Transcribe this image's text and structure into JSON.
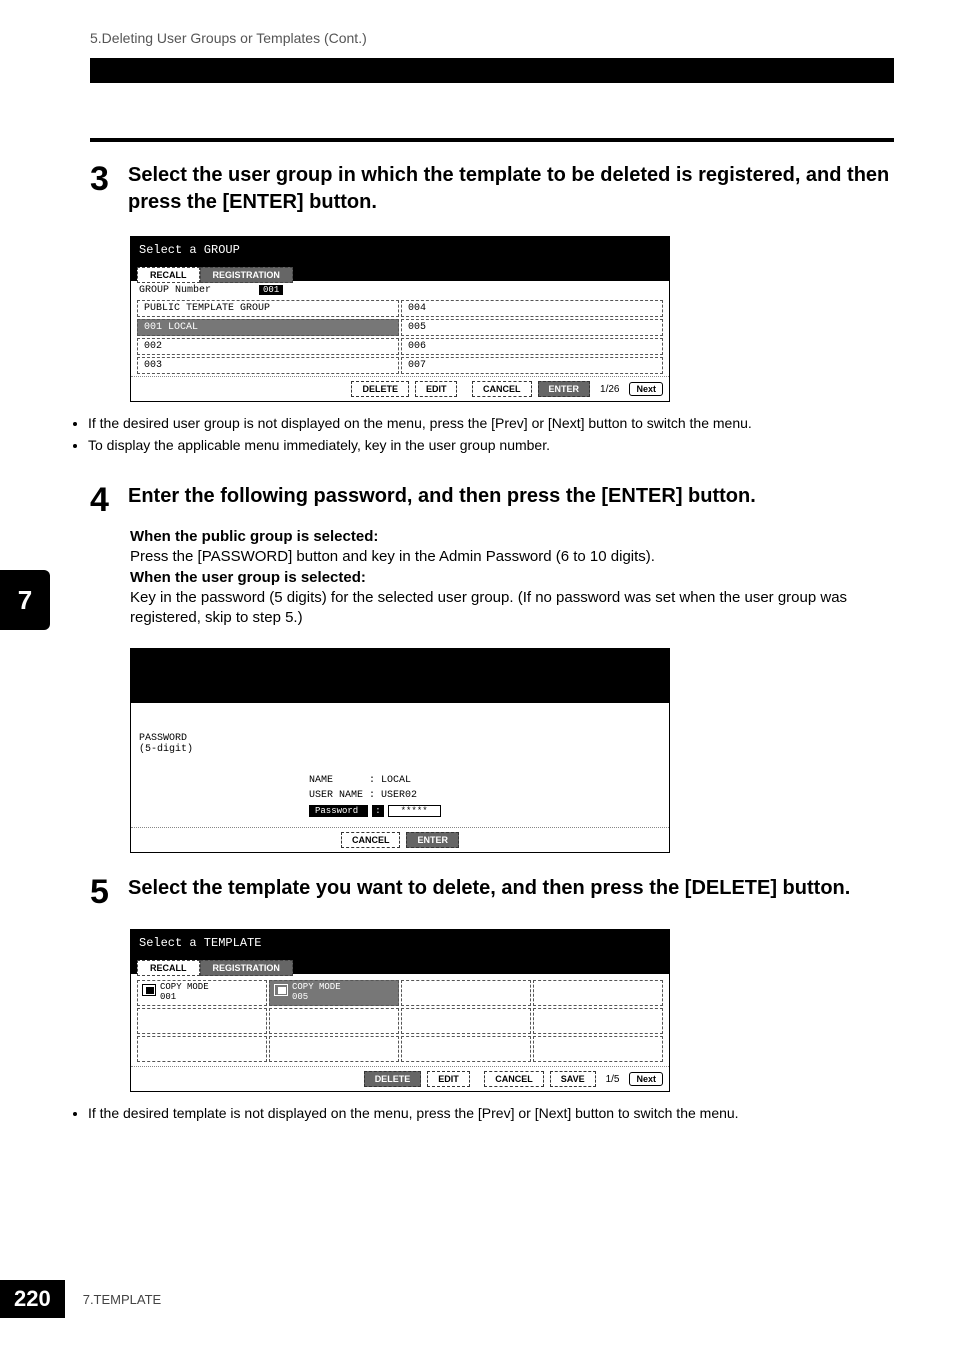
{
  "breadcrumb": "5.Deleting User Groups or Templates (Cont.)",
  "side_tab": "7",
  "steps": {
    "s3": {
      "num": "3",
      "title": "Select the user group in which the template to be deleted is registered, and then press the [ENTER] button."
    },
    "s4": {
      "num": "4",
      "title": "Enter the following password, and then press the [ENTER] button.",
      "body_bold1": "When the public group is selected:",
      "body_line1": "Press the [PASSWORD] button and key in the Admin Password (6 to 10 digits).",
      "body_bold2": "When the user group is selected:",
      "body_line2": "Key in the password (5 digits) for the selected user group. (If no password was set when the user group was registered, skip to step 5.)"
    },
    "s5": {
      "num": "5",
      "title": "Select the template you want to delete, and then press the [DELETE] button."
    }
  },
  "bullets_after_s3": {
    "b1": "If the desired user group is not displayed on the menu, press the [Prev] or [Next] button to switch the menu.",
    "b2": "To display the applicable menu immediately, key in the user group number."
  },
  "bullets_after_s5": {
    "b1": "If the desired template is not displayed on the menu, press the [Prev] or [Next] button to switch the menu."
  },
  "shot1": {
    "title": "Select a GROUP",
    "tab_recall": "RECALL",
    "tab_registration": "REGISTRATION",
    "group_number_label": "GROUP Number",
    "group_number_value": "001",
    "cells": [
      "PUBLIC TEMPLATE GROUP",
      "004",
      "001 LOCAL",
      "005",
      "002",
      "006",
      "003",
      "007"
    ],
    "btn_delete": "DELETE",
    "btn_edit": "EDIT",
    "btn_cancel": "CANCEL",
    "btn_enter": "ENTER",
    "pager": "1/26",
    "btn_next": "Next"
  },
  "shot2": {
    "label": "PASSWORD\n(5-digit)",
    "name_row": "NAME      : LOCAL",
    "user_row": "USER NAME : USER02",
    "pw_label": "Password",
    "pw_value": "*****",
    "btn_cancel": "CANCEL",
    "btn_enter": "ENTER"
  },
  "shot3": {
    "title": "Select a TEMPLATE",
    "tab_recall": "RECALL",
    "tab_registration": "REGISTRATION",
    "cells": [
      "COPY MODE\n001",
      "COPY MODE\n005"
    ],
    "btn_delete": "DELETE",
    "btn_edit": "EDIT",
    "btn_cancel": "CANCEL",
    "btn_save": "SAVE",
    "pager": "1/5",
    "btn_next": "Next"
  },
  "footer": {
    "page_number": "220",
    "section": "7.TEMPLATE"
  }
}
